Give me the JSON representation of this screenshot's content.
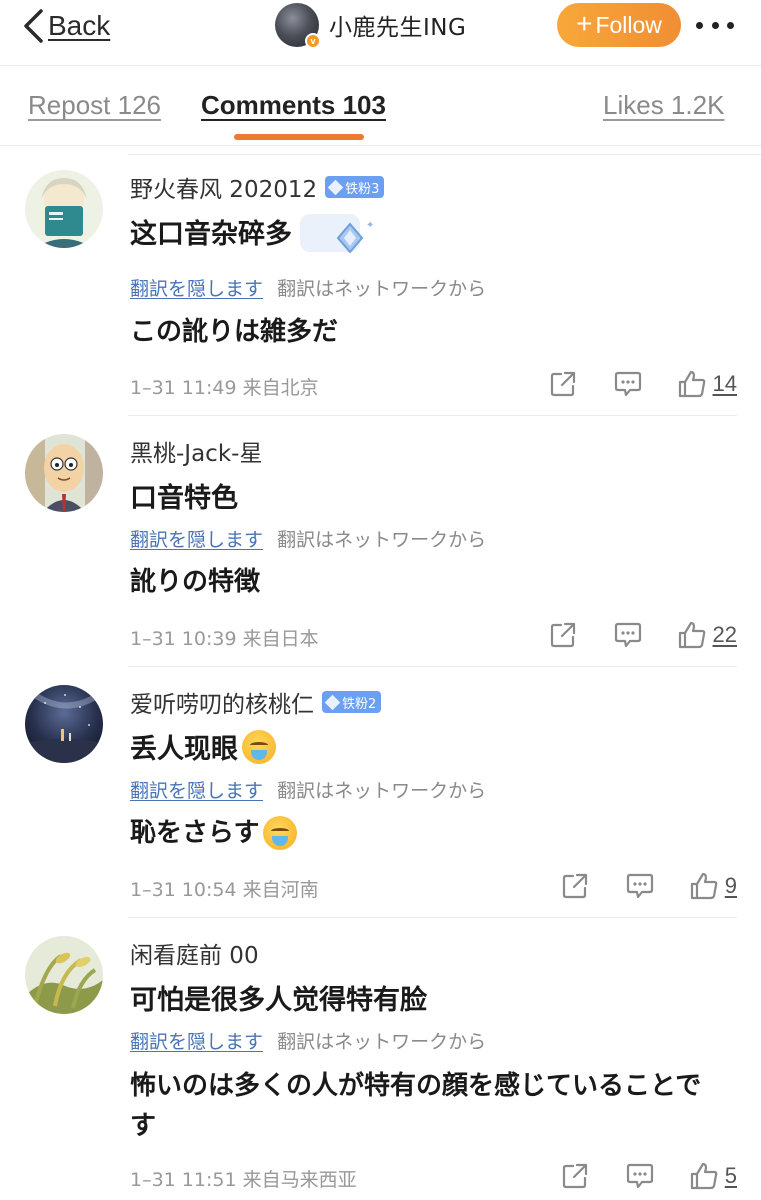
{
  "header": {
    "back_label": "Back",
    "profile_name": "小鹿先生ING",
    "verified_badge": "v",
    "follow_label": "Follow",
    "more_icon": "more-horizontal-icon"
  },
  "tabs": [
    {
      "label": "Repost 126",
      "active": false
    },
    {
      "label": "Comments 103",
      "active": true
    },
    {
      "label": "Likes 1.2K",
      "active": false
    }
  ],
  "colors": {
    "accent": "#ee7a32",
    "follow_button": "#f39a35",
    "link_blue": "#4a74b8",
    "fan_badge": "#6b9ff1"
  },
  "comments": [
    {
      "username": "野火春风 202012",
      "badge": "铁粉3",
      "text": "这口音杂碎多",
      "hide_translation": "翻訳を隠します",
      "translation_source": "翻訳はネットワークから",
      "translation": "この訛りは雑多だ",
      "meta": "1–31 11:49  来自北京",
      "likes": "14"
    },
    {
      "username": "黑桃-Jack-星",
      "badge": "",
      "text": "口音特色",
      "hide_translation": "翻訳を隠します",
      "translation_source": "翻訳はネットワークから",
      "translation": "訛りの特徴",
      "meta": "1–31 10:39  来自日本",
      "likes": "22"
    },
    {
      "username": "爱听唠叨的核桃仁",
      "badge": "铁粉2",
      "text": "丢人现眼",
      "hide_translation": "翻訳を隠します",
      "translation_source": "翻訳はネットワークから",
      "translation": "恥をさらす",
      "meta": "1–31 10:54  来自河南",
      "likes": "9"
    },
    {
      "username": "闲看庭前 00",
      "badge": "",
      "text": "可怕是很多人觉得特有脸",
      "hide_translation": "翻訳を隠します",
      "translation_source": "翻訳はネットワークから",
      "translation_line1": "怖いのは多くの人が特有の顔を感じていることで",
      "translation_line2": "す",
      "meta": "1–31 11:51  来自马来西亚",
      "likes": "5"
    }
  ]
}
